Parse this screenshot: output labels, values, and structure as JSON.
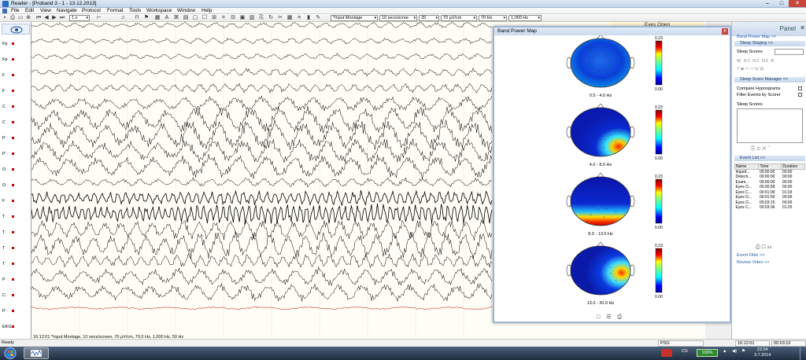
{
  "window": {
    "title": "Reader - [Proband 3 - 1 - 13.12.2013]",
    "min": "–",
    "max": "□",
    "close": "✕"
  },
  "menu": [
    "File",
    "Edit",
    "View",
    "Navigate",
    "Protocol",
    "Format",
    "Tools",
    "Workspace",
    "Window",
    "Help"
  ],
  "toolbar": {
    "zoom_value": "1 x",
    "montage": "*Input Montage",
    "speed": "10 secs/scree",
    "channels": "20",
    "sensitivity": "70 µV/cm",
    "lowpass": "70 Hz",
    "highpass": "1,000 Hz"
  },
  "channels": [
    "Fp",
    "Fp",
    "F",
    "F",
    "C",
    "C",
    "P",
    "P",
    "O",
    "O",
    "F",
    "T",
    "T",
    "T",
    "T",
    "P",
    "C",
    "P",
    "EKG"
  ],
  "eeg_status": "16:12:01  *Input Montage, 10 secs/screen, 70 µV/cm, 70,0 Hz, 1,000 Hz, 50 Hz",
  "eyes_open_label": "Eyes Open",
  "band_power_map": {
    "title": "Band Power Map",
    "close": "✕",
    "maps": [
      {
        "band": "0.5 - 4.0 Hz",
        "scale_max": "0.23",
        "scale_min": "0.00"
      },
      {
        "band": "4.0 - 8.0 Hz",
        "scale_max": "0.23",
        "scale_min": "0.00"
      },
      {
        "band": "8.0 - 13.0 Hz",
        "scale_max": "0.23",
        "scale_min": "0.00"
      },
      {
        "band": "13.0 - 30.0 Hz",
        "scale_max": "0.23",
        "scale_min": "0.00"
      }
    ],
    "footer_icons": [
      "□",
      "☰",
      "⎙"
    ]
  },
  "panel": {
    "title": "Panel",
    "close": "✕",
    "band_power_link": "Band Power Map >>",
    "sleep_staging": "Sleep Staging <<",
    "sleep_scores_label": "Sleep Scores",
    "stage_buttons": "W  N1  N2  N3  R",
    "sleep_score_manager": "Sleep Score Manager <<",
    "compare_hypnograms": "Compare Hypnograms",
    "filter_events": "Filter Events by Scorer",
    "sleep_scores_list_label": "Sleep Scores",
    "event_list": "Event List <<",
    "event_columns": [
      "Name",
      "Time",
      "Duration"
    ],
    "events": [
      [
        "Imped...",
        "00:00:00",
        "00:00"
      ],
      [
        "Detecti...",
        "00:00:00",
        "00:00"
      ],
      [
        "Exam...",
        "00:00:00",
        "00:00"
      ],
      [
        "Eyes O...",
        "00:00:58",
        "00:00"
      ],
      [
        "Eyes C...",
        "00:01:09",
        "01:03"
      ],
      [
        "Eyes O...",
        "00:01:59",
        "00:00"
      ],
      [
        "Eyes O...",
        "00:03:15",
        "00:00"
      ],
      [
        "Eyes C...",
        "00:03:36",
        "01:25"
      ]
    ],
    "event_filter": "Event Filter >>",
    "review_video": "Review Video >>"
  },
  "status": {
    "ready": "Ready",
    "psg": "PSG",
    "time1": "16:12:01",
    "time2": "00:03:10"
  },
  "taskbar": {
    "lang": "CS",
    "battery": "100%",
    "time": "23:24",
    "date": "3.7.2014"
  },
  "colors": {
    "eeg_trace": "#000000",
    "ekg_trace": "#c00000",
    "accent": "#2a5db0"
  }
}
